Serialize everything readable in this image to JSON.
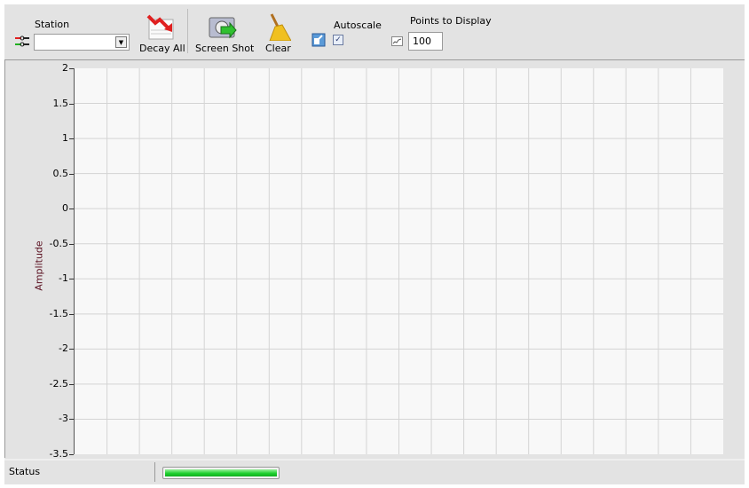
{
  "toolbar": {
    "station_label": "Station",
    "station_value": "",
    "decay_all_label": "Decay All",
    "screen_shot_label": "Screen Shot",
    "clear_label": "Clear",
    "autoscale_label": "Autoscale",
    "autoscale_checked": true,
    "points_label": "Points to Display",
    "points_value": "100"
  },
  "graph": {
    "y_axis_label": "Amplitude",
    "y_ticks": [
      "2",
      "1.5",
      "1",
      "0.5",
      "0",
      "-0.5",
      "-1",
      "-1.5",
      "-2",
      "-2.5",
      "-3",
      "-3.5"
    ]
  },
  "chart_data": {
    "type": "line",
    "ylabel": "Amplitude",
    "xlabel": "",
    "ylim": [
      -3.5,
      2
    ],
    "grid": true,
    "series": []
  },
  "status": {
    "label": "Status",
    "progress": 1.0,
    "progress_color": "#1fd030"
  }
}
